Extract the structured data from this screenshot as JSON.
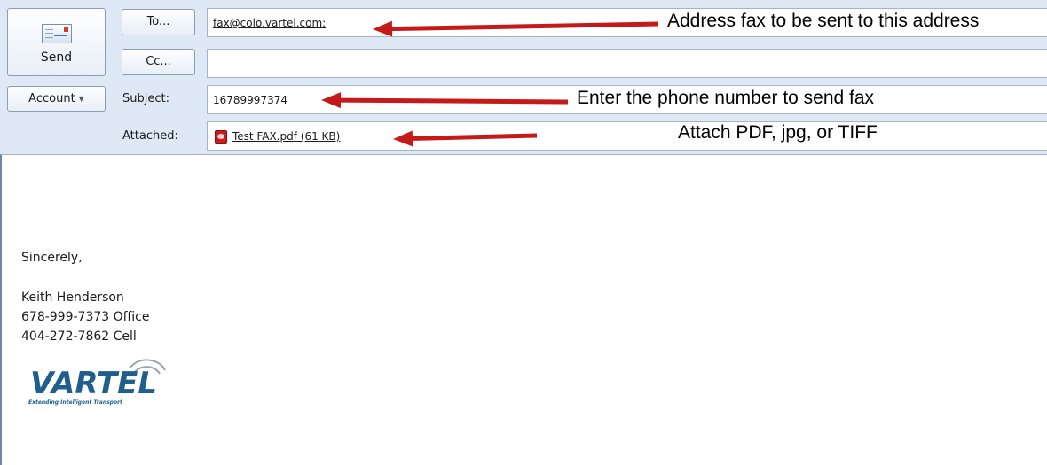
{
  "compose": {
    "send_label": "Send",
    "to_button": "To...",
    "cc_button": "Cc...",
    "account_button": "Account",
    "subject_label": "Subject:",
    "attached_label": "Attached:",
    "to_value": "fax@colo.vartel.com;",
    "cc_value": "",
    "subject_value": "16789997374",
    "attachment_name": "Test FAX.pdf (61 KB)"
  },
  "annotations": {
    "to_note": "Address fax to be sent to this address",
    "subject_note": "Enter the phone number to send fax",
    "attach_note": "Attach PDF, jpg, or TIFF",
    "arrow_color": "#c61a1a"
  },
  "message_body": {
    "closing": "Sincerely,",
    "name": "Keith Henderson",
    "office": "678-999-7373 Office",
    "cell": "404-272-7862 Cell"
  },
  "logo": {
    "name": "VARTEL",
    "tagline": "Extending Intelligent Transport"
  }
}
